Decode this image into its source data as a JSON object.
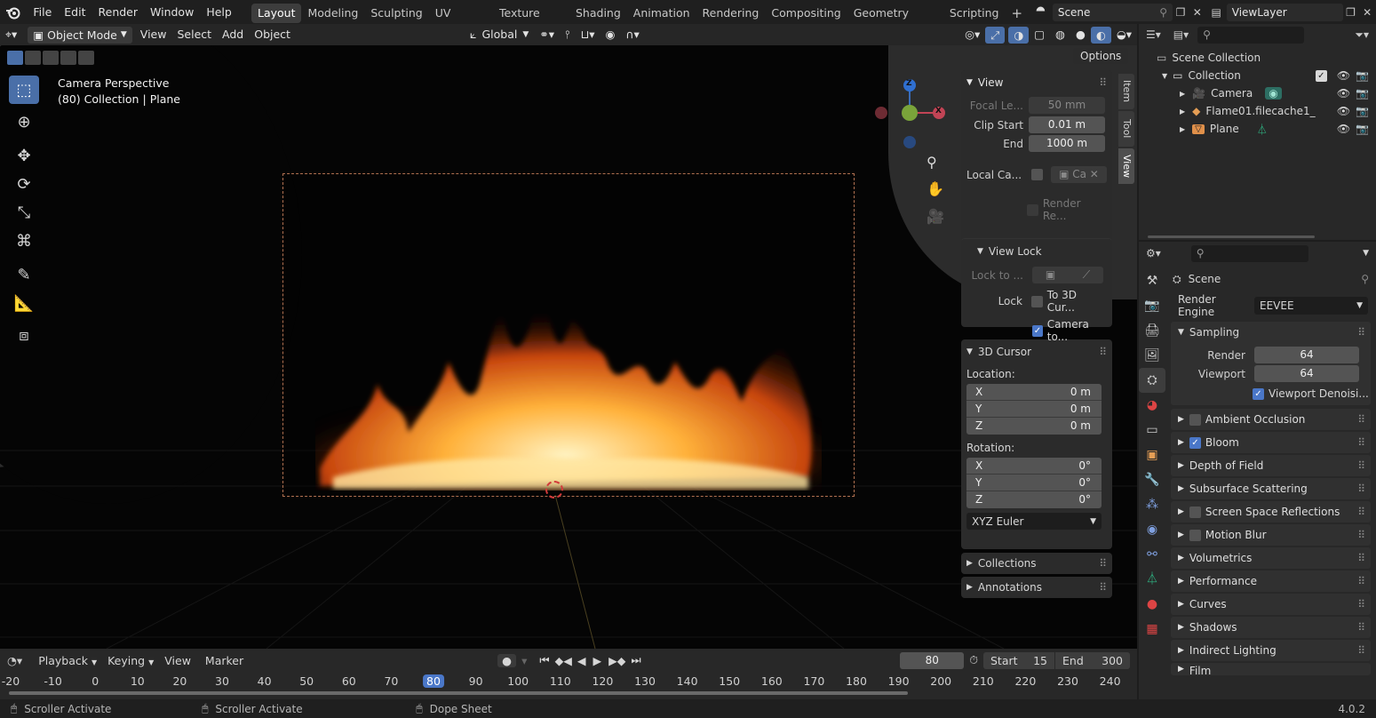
{
  "menubar": {
    "items": [
      "File",
      "Edit",
      "Render",
      "Window",
      "Help"
    ],
    "workspaces": [
      "Layout",
      "Modeling",
      "Sculpting",
      "UV Editing",
      "Texture Paint",
      "Shading",
      "Animation",
      "Rendering",
      "Compositing",
      "Geometry Nodes",
      "Scripting"
    ],
    "active_workspace": "Layout",
    "add_tab": "+",
    "scene": "Scene",
    "view_layer": "ViewLayer"
  },
  "viewport_header": {
    "mode": "Object Mode",
    "menus": [
      "View",
      "Select",
      "Add",
      "Object"
    ],
    "orientation": "Global",
    "options": "Options"
  },
  "viewport": {
    "camera_label": "Camera Perspective",
    "collection_label": "(80) Collection",
    "object_label": "Plane",
    "gizmo": {
      "z": "Z",
      "x": "X"
    }
  },
  "sidebar_tabs": [
    "Item",
    "Tool",
    "View"
  ],
  "npanel": {
    "view": {
      "title": "View",
      "focal_label": "Focal Le...",
      "focal_value": "50 mm",
      "clip_start_label": "Clip Start",
      "clip_start_value": "0.01 m",
      "end_label": "End",
      "end_value": "1000 m",
      "local_camera_label": "Local Ca...",
      "local_camera_value": "Ca",
      "render_region_label": "Render Re..."
    },
    "view_lock": {
      "title": "View Lock",
      "lock_to_label": "Lock to ...",
      "lock_label": "Lock",
      "to_cursor": "To 3D Cur...",
      "camera_to": "Camera to..."
    },
    "cursor": {
      "title": "3D Cursor",
      "location_label": "Location:",
      "location": [
        {
          "axis": "X",
          "value": "0 m"
        },
        {
          "axis": "Y",
          "value": "0 m"
        },
        {
          "axis": "Z",
          "value": "0 m"
        }
      ],
      "rotation_label": "Rotation:",
      "rotation": [
        {
          "axis": "X",
          "value": "0°"
        },
        {
          "axis": "Y",
          "value": "0°"
        },
        {
          "axis": "Z",
          "value": "0°"
        }
      ],
      "rotation_mode": "XYZ Euler"
    },
    "collections": "Collections",
    "annotations": "Annotations"
  },
  "outliner": {
    "scene_collection": "Scene Collection",
    "collection": "Collection",
    "items": [
      "Camera",
      "Flame01.filecache1_",
      "Plane"
    ]
  },
  "properties": {
    "title": "Scene",
    "render_engine_label": "Render Engine",
    "render_engine": "EEVEE",
    "sampling": "Sampling",
    "render_label": "Render",
    "render_value": "64",
    "viewport_label": "Viewport",
    "viewport_value": "64",
    "viewport_denoise": "Viewport Denoisi...",
    "sections": [
      {
        "label": "Ambient Occlusion",
        "checkbox": "off"
      },
      {
        "label": "Bloom",
        "checkbox": "on"
      },
      {
        "label": "Depth of Field",
        "checkbox": "none"
      },
      {
        "label": "Subsurface Scattering",
        "checkbox": "none"
      },
      {
        "label": "Screen Space Reflections",
        "checkbox": "off"
      },
      {
        "label": "Motion Blur",
        "checkbox": "off"
      },
      {
        "label": "Volumetrics",
        "checkbox": "none"
      },
      {
        "label": "Performance",
        "checkbox": "none"
      },
      {
        "label": "Curves",
        "checkbox": "none"
      },
      {
        "label": "Shadows",
        "checkbox": "none"
      },
      {
        "label": "Indirect Lighting",
        "checkbox": "none"
      },
      {
        "label": "Film",
        "checkbox": "none"
      }
    ]
  },
  "timeline": {
    "menus": [
      "Playback",
      "Keying",
      "View",
      "Marker"
    ],
    "current_frame": "80",
    "start_label": "Start",
    "start_value": "15",
    "end_label": "End",
    "end_value": "300",
    "ticks": [
      "-20",
      "-10",
      "0",
      "10",
      "20",
      "30",
      "40",
      "50",
      "60",
      "70",
      "80",
      "90",
      "100",
      "110",
      "120",
      "130",
      "140",
      "150",
      "160",
      "170",
      "180",
      "190",
      "200",
      "210",
      "220",
      "230",
      "240"
    ]
  },
  "statusbar": {
    "items": [
      "Scroller Activate",
      "Scroller Activate",
      "Dope Sheet"
    ],
    "version": "4.0.2"
  },
  "colors": {
    "accent": "#4a77c8",
    "active_frame": "#4a77c8",
    "flame": "#ff9a2a"
  }
}
